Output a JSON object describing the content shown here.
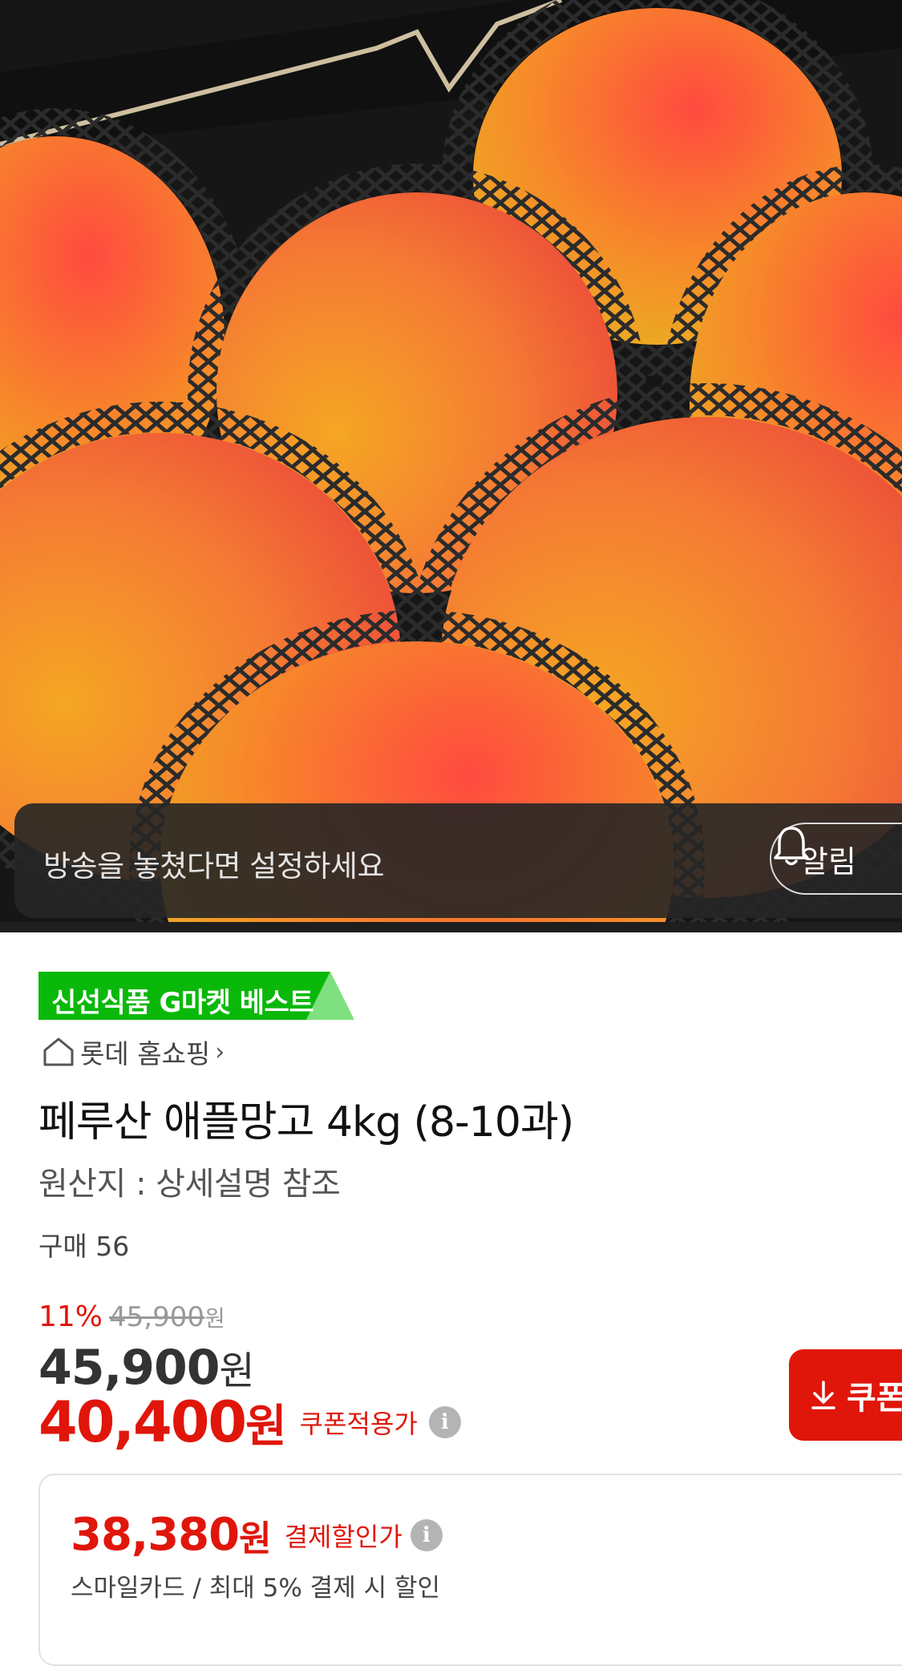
{
  "hero": {
    "banner_text": "방송을 놓쳤다면 설정하세요",
    "alarm_label": "알림"
  },
  "badge": {
    "text": "신선식품 G마켓 베스트",
    "color": "#0ab80a"
  },
  "store": {
    "name": "롯데 홈쇼핑",
    "chevron": "›"
  },
  "product": {
    "title": "페루산 애플망고 4kg (8-10과)",
    "origin": "원산지 : 상세설명 참조",
    "purchase": "구매 56"
  },
  "price": {
    "discount": "11%",
    "original": "45,900",
    "original_unit": "원",
    "sale": "45,900",
    "sale_unit": "원",
    "coupon_price": "40,400",
    "coupon_unit": "원",
    "coupon_label": "쿠폰적용가",
    "coupon_button": "쿠폰"
  },
  "payment": {
    "price": "38,380",
    "unit": "원",
    "label": "결제할인가",
    "sub": "스마일카드 / 최대 5% 결제 시 할인"
  },
  "colors": {
    "accent": "#e0160b",
    "badge_green": "#0ab80a"
  }
}
